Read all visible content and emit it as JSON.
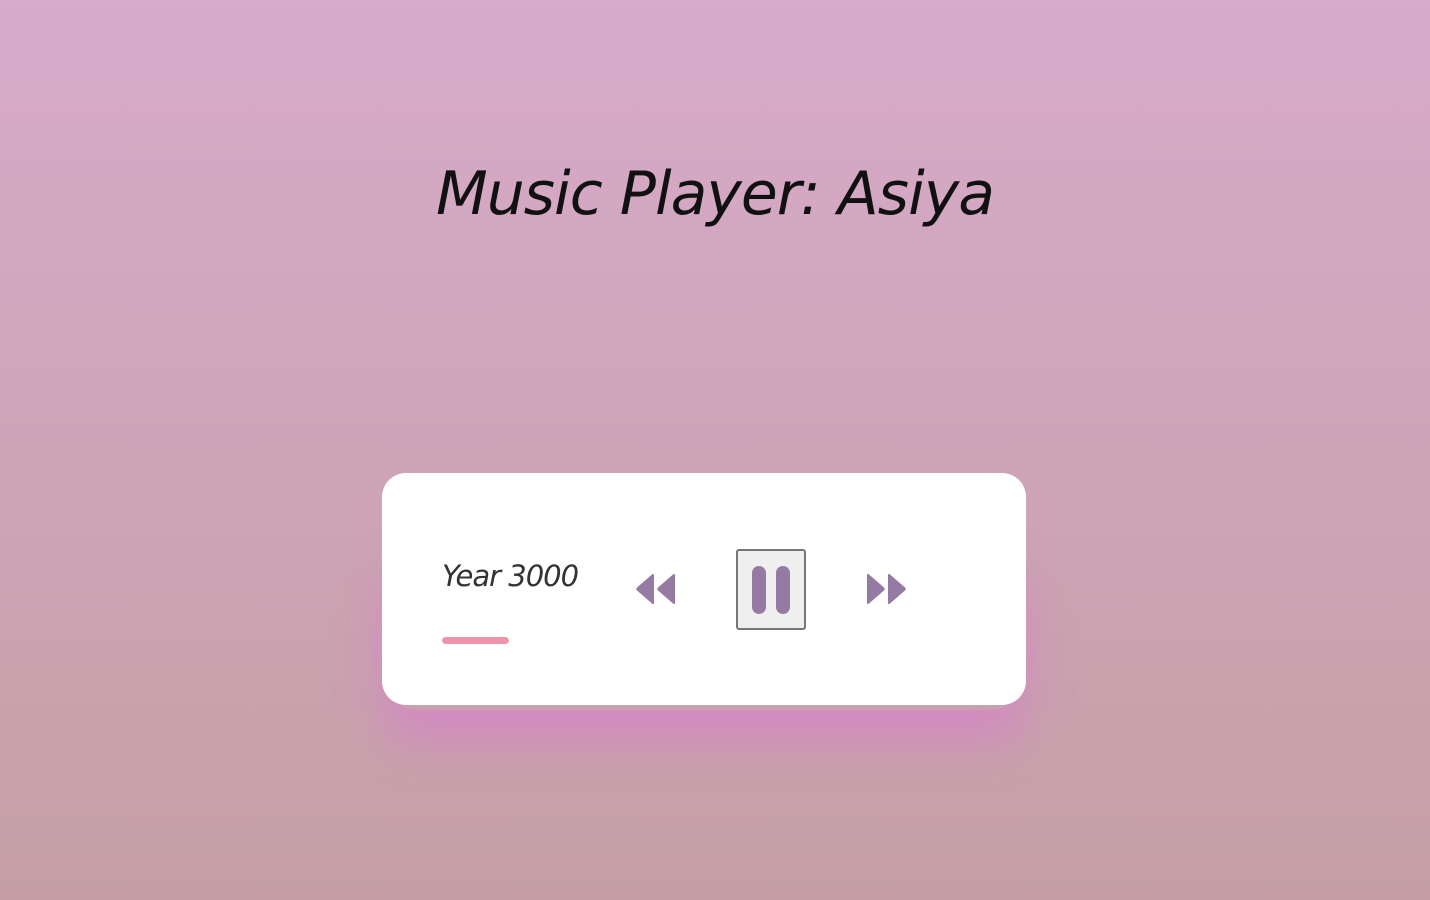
{
  "page": {
    "title": "Music Player: Asiya"
  },
  "player": {
    "track_title": "Year 3000",
    "progress_fraction": 0.05,
    "is_playing": true,
    "controls": {
      "prev_icon": "backward-icon",
      "play_pause_icon": "pause-icon",
      "next_icon": "forward-icon"
    }
  },
  "colors": {
    "background_top": "#d8aacb",
    "background_bottom": "#c59fa5",
    "card": "#ffffff",
    "icon": "#957ba3",
    "progress": "#ee93ab",
    "glow": "#d682c8"
  }
}
